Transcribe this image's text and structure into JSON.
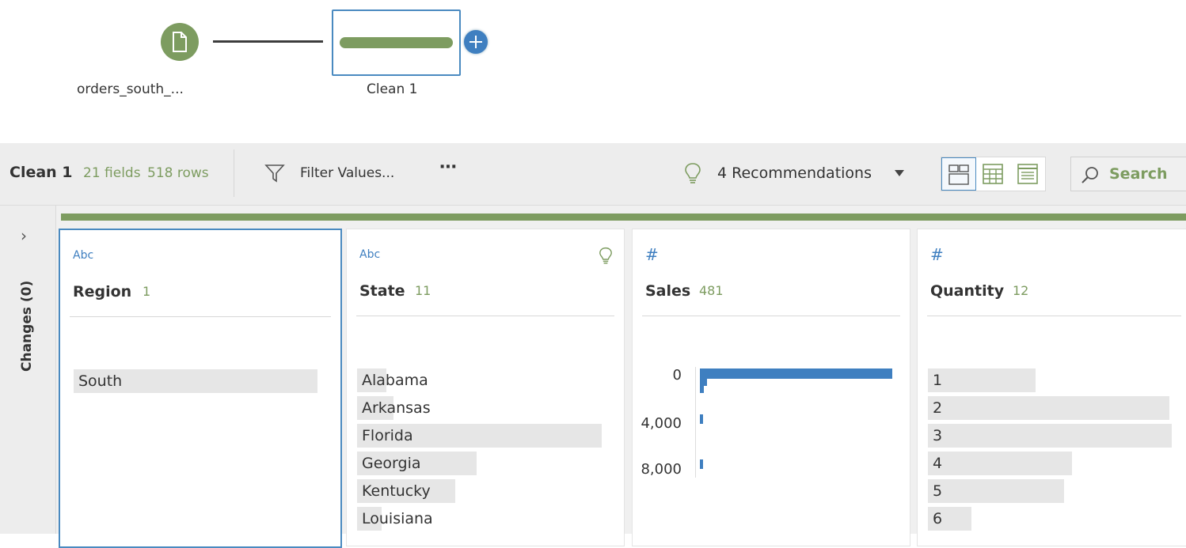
{
  "flow": {
    "input_node_label": "orders_south_...",
    "clean_node_label": "Clean 1"
  },
  "toolbar": {
    "title": "Clean 1",
    "fields": "21 fields",
    "rows": "518 rows",
    "filter_label": "Filter Values...",
    "more_label": "⋯",
    "recommendations": "4 Recommendations",
    "search_label": "Search"
  },
  "rail": {
    "changes_label": "Changes (0)"
  },
  "icons": {
    "input": "file-icon",
    "add": "plus-icon",
    "filter": "filter-icon",
    "recommendation": "lightbulb-icon",
    "views": [
      "profile-view-icon",
      "data-grid-icon",
      "list-view-icon"
    ],
    "search": "search-icon",
    "expand": "chevron-right-icon"
  },
  "colors": {
    "accent_green": "#7d9c60",
    "accent_blue": "#3f7fc0"
  },
  "cards": [
    {
      "type": "Abc",
      "name": "Region",
      "count": "1",
      "values": [
        {
          "label": "South",
          "share": 1.0
        }
      ]
    },
    {
      "type": "Abc",
      "name": "State",
      "count": "11",
      "values": [
        {
          "label": "Alabama",
          "share": 0.12
        },
        {
          "label": "Arkansas",
          "share": 0.15
        },
        {
          "label": "Florida",
          "share": 1.0
        },
        {
          "label": "Georgia",
          "share": 0.49
        },
        {
          "label": "Kentucky",
          "share": 0.4
        },
        {
          "label": "Louisiana",
          "share": 0.1
        }
      ]
    },
    {
      "type": "#",
      "name": "Sales",
      "count": "481",
      "ticks": [
        "0",
        "4,000",
        "8,000"
      ],
      "histogram": [
        1.0,
        0.035,
        0.02,
        0.0,
        0.0,
        0.0,
        0.013,
        0.0,
        0.0,
        0.0,
        0.0,
        0.0,
        0.013
      ]
    },
    {
      "type": "#",
      "name": "Quantity",
      "count": "12",
      "values": [
        {
          "label": "1",
          "share": 0.44
        },
        {
          "label": "2",
          "share": 0.99
        },
        {
          "label": "3",
          "share": 1.0
        },
        {
          "label": "4",
          "share": 0.59
        },
        {
          "label": "5",
          "share": 0.56
        },
        {
          "label": "6",
          "share": 0.18
        }
      ]
    }
  ]
}
